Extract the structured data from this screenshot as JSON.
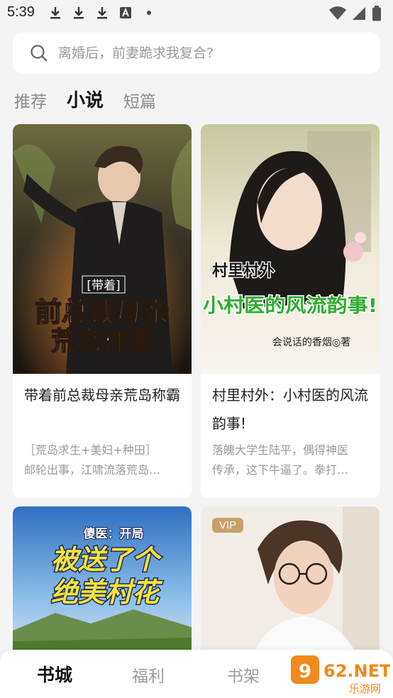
{
  "status_bar": {
    "time": "5:39",
    "icons": [
      "download-icon",
      "download-icon",
      "download-icon",
      "a-badge-icon",
      "dot-icon"
    ],
    "right_icons": [
      "wifi-icon",
      "signal-icon",
      "battery-icon"
    ]
  },
  "search": {
    "placeholder": "离婚后，前妻跪求我复合?"
  },
  "tabs": [
    {
      "label": "推荐",
      "active": false
    },
    {
      "label": "小说",
      "active": true
    },
    {
      "label": "短篇",
      "active": false
    }
  ],
  "books": [
    {
      "cover_tag": "[带着]",
      "cover_line1": "前总裁母亲",
      "cover_line2": "荒岛称霸",
      "title": "带着前总裁母亲荒岛称霸",
      "desc_line1": "［荒岛求生+美妇+种田］",
      "desc_line2": "邮轮出事，江啸流落荒岛…"
    },
    {
      "cover_tag": "村里村外",
      "cover_line1": "小村医的风流韵事!",
      "cover_author": "会说话的香烟◎著",
      "title": "村里村外：小村医的风流韵事!",
      "desc_line1": "落魄大学生陆平，偶得神医",
      "desc_line2": "传承，这下牛逼了。拳打…"
    },
    {
      "cover_tag": "傻医：开局",
      "cover_line1": "被送了个",
      "cover_line2": "绝美村花"
    },
    {
      "badge": "VIP"
    }
  ],
  "bottom_nav": [
    {
      "label": "书城",
      "active": true
    },
    {
      "label": "福利",
      "active": false
    },
    {
      "label": "书架",
      "active": false
    }
  ],
  "watermark": {
    "logo": "962.NET",
    "sub": "乐游网"
  },
  "colors": {
    "accent_green": "#e23bd0",
    "brand_orange": "#f08a1c",
    "bg": "#f4f4f5"
  }
}
